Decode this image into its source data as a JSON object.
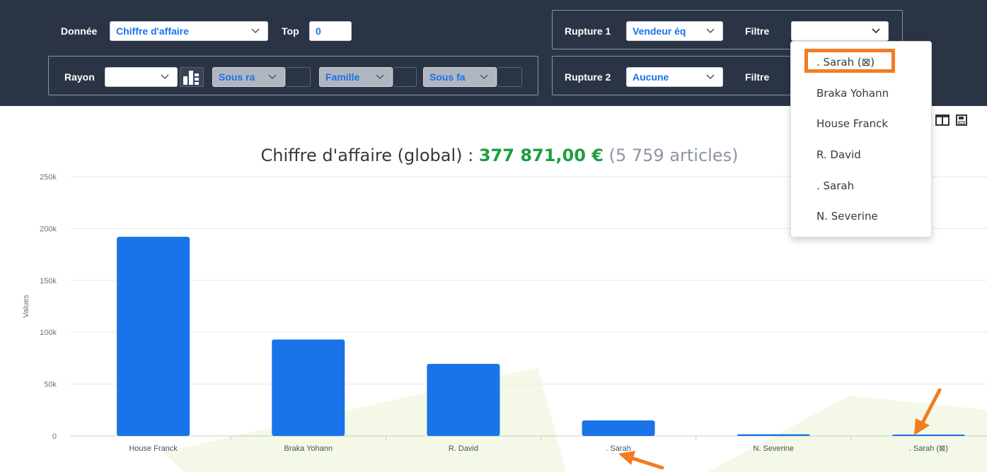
{
  "toolbar": {
    "donnee_label": "Donnée",
    "donnee_value": "Chiffre d'affaire",
    "top_label": "Top",
    "top_value": "0",
    "rayon_label": "Rayon",
    "rayon_value": "",
    "sous_rayon_value": "Sous ra",
    "famille_value": "Famille",
    "sous_famille_value": "Sous fa",
    "rupture1_label": "Rupture 1",
    "rupture1_value": "Vendeur éq",
    "filtre1_label": "Filtre",
    "filtre1_value": "",
    "rupture2_label": "Rupture 2",
    "rupture2_value": "Aucune",
    "filtre2_label": "Filtre"
  },
  "dropdown": {
    "items": [
      ". Sarah (⊠)",
      "Braka Yohann",
      "House Franck",
      "R. David",
      ". Sarah",
      "N. Severine"
    ],
    "highlighted_index": 0
  },
  "view_icons": [
    "store-icon",
    "columns-icon",
    "save-icon"
  ],
  "title": {
    "prefix": "Chiffre d'affaire (global) : ",
    "amount": "377 871,00 €",
    "count": "(5 759 articles)"
  },
  "colors": {
    "bar": "#1a73e8",
    "toolbar_bg": "#2b3445",
    "highlight": "#f47b20",
    "amount": "#1e9e3e"
  },
  "chart_data": {
    "type": "bar",
    "categories": [
      "House Franck",
      "Braka Yohann",
      "R. David",
      ". Sarah",
      "N. Severine",
      ". Sarah (⊠)"
    ],
    "values": [
      192000,
      93000,
      69500,
      15000,
      1600,
      900
    ],
    "ylabel": "Values",
    "ylim": [
      0,
      250000
    ],
    "yticks": [
      0,
      50000,
      100000,
      150000,
      200000,
      250000
    ],
    "ytick_labels": [
      "0",
      "50k",
      "100k",
      "150k",
      "200k",
      "250k"
    ],
    "grid": true
  }
}
